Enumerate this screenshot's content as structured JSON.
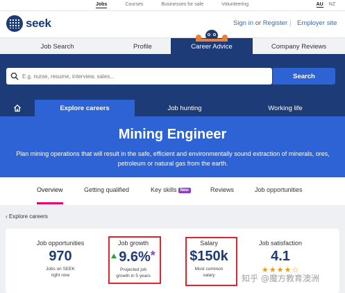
{
  "topbar": {
    "links": [
      "Jobs",
      "Courses",
      "Businesses for sale",
      "Volunteering"
    ],
    "active_link": "Jobs",
    "countries": [
      "AU",
      "NZ"
    ],
    "active_country": "AU"
  },
  "header": {
    "logo_text": "seek",
    "sign_in": "Sign in",
    "or": "or",
    "register": "Register",
    "separator": "|",
    "employer_site": "Employer site"
  },
  "main_tabs": [
    "Job Search",
    "Profile",
    "Career Advice",
    "Company Reviews"
  ],
  "main_tabs_active": "Career Advice",
  "search": {
    "placeholder": "E.g. nurse, resume, interview, sales...",
    "button": "Search"
  },
  "sub_nav": {
    "home_icon": "home-icon",
    "tabs": [
      "Explore careers",
      "Job hunting",
      "Working life"
    ],
    "active": "Explore careers"
  },
  "hero": {
    "title": "Mining Engineer",
    "description": "Plan mining operations that will result in the safe, efficient and environmentally sound extraction of minerals, ores, petroleum or natural gas from the earth."
  },
  "section_tabs": {
    "items": [
      "Overview",
      "Getting qualified",
      "Key skills",
      "Reviews",
      "Job opportunities"
    ],
    "new_badge": "New",
    "active": "Overview"
  },
  "breadcrumb": {
    "label": "Explore careers",
    "chevron": "‹"
  },
  "stats": {
    "job_opportunities": {
      "label": "Job opportunities",
      "value": "970",
      "sub1": "Jobs on SEEK",
      "sub2": "right now"
    },
    "job_growth": {
      "label": "Job growth",
      "value": "9.6%",
      "marker": "*",
      "sub1": "Projected job",
      "sub2": "growth in 5 years"
    },
    "salary": {
      "label": "Salary",
      "value": "$150k",
      "sub1": "Most common",
      "sub2": "salary"
    },
    "job_satisfaction": {
      "label": "Job satisfaction",
      "value": "4.1",
      "rating": 4.1,
      "rating_max": 5
    }
  },
  "watermark": "知乎 @魔方教育澳洲",
  "colors": {
    "navy": "#1c3b77",
    "blue": "#2e63d6",
    "pink": "#e3006f",
    "highlight": "#e5202a",
    "growth_green": "#2e9c4a",
    "star": "#e99a17",
    "new_badge": "#8a3fc7"
  }
}
